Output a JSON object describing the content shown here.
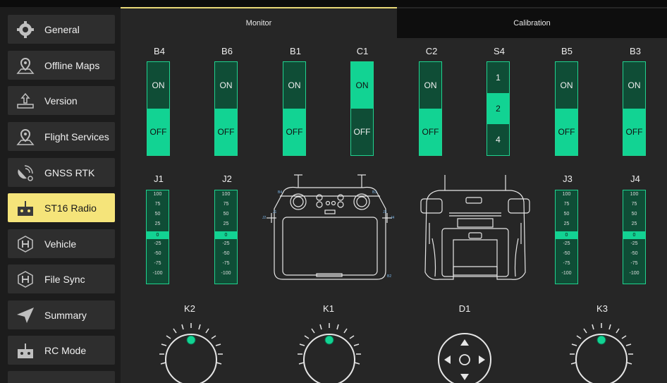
{
  "sidebar": {
    "items": [
      {
        "label": "General",
        "icon": "gear-icon",
        "active": false
      },
      {
        "label": "Offline Maps",
        "icon": "map-pin-icon",
        "active": false
      },
      {
        "label": "Version",
        "icon": "upload-icon",
        "active": false
      },
      {
        "label": "Flight Services",
        "icon": "map-pin-icon",
        "active": false
      },
      {
        "label": "GNSS RTK",
        "icon": "satellite-icon",
        "active": false
      },
      {
        "label": "ST16 Radio",
        "icon": "radio-icon",
        "active": true
      },
      {
        "label": "Vehicle",
        "icon": "hexagon-h-icon",
        "active": false
      },
      {
        "label": "File Sync",
        "icon": "hexagon-h-icon",
        "active": false
      },
      {
        "label": "Summary",
        "icon": "paper-plane-icon",
        "active": false
      },
      {
        "label": "RC Mode",
        "icon": "radio-icon",
        "active": false
      }
    ]
  },
  "tabs": {
    "monitor": "Monitor",
    "calibration": "Calibration"
  },
  "switches": [
    {
      "name": "B4",
      "on": "ON",
      "off": "OFF",
      "state": "off"
    },
    {
      "name": "B6",
      "on": "ON",
      "off": "OFF",
      "state": "off"
    },
    {
      "name": "B1",
      "on": "ON",
      "off": "OFF",
      "state": "off"
    },
    {
      "name": "C1",
      "on": "ON",
      "off": "OFF",
      "state": "on"
    },
    {
      "name": "C2",
      "on": "ON",
      "off": "OFF",
      "state": "off"
    },
    {
      "name": "S4",
      "positions": [
        "1",
        "2",
        "4"
      ],
      "state": "2"
    },
    {
      "name": "B5",
      "on": "ON",
      "off": "OFF",
      "state": "off"
    },
    {
      "name": "B3",
      "on": "ON",
      "off": "OFF",
      "state": "off"
    }
  ],
  "sticks": [
    {
      "name": "J1",
      "ticks": [
        "100",
        "75",
        "50",
        "25",
        "0",
        "-25",
        "-50",
        "-75",
        "-100"
      ],
      "value": 0
    },
    {
      "name": "J2",
      "ticks": [
        "100",
        "75",
        "50",
        "25",
        "0",
        "-25",
        "-50",
        "-75",
        "-100"
      ],
      "value": 0
    },
    {
      "name": "J3",
      "ticks": [
        "100",
        "75",
        "50",
        "25",
        "0",
        "-25",
        "-50",
        "-75",
        "-100"
      ],
      "value": 0
    },
    {
      "name": "J4",
      "ticks": [
        "100",
        "75",
        "50",
        "25",
        "0",
        "-25",
        "-50",
        "-75",
        "-100"
      ],
      "value": 0
    }
  ],
  "controller_front_labels": {
    "b4": "B4",
    "b3": "B3",
    "j1": "J1",
    "j2": "J2",
    "j3": "J3",
    "j4": "J4",
    "b2": "B2"
  },
  "knobs": [
    {
      "name": "K2"
    },
    {
      "name": "K1"
    },
    {
      "name": "D1"
    },
    {
      "name": "K3"
    }
  ],
  "colors": {
    "accent": "#12d393",
    "active_nav": "#f5e47a",
    "tab_indicator": "#e8d978"
  }
}
